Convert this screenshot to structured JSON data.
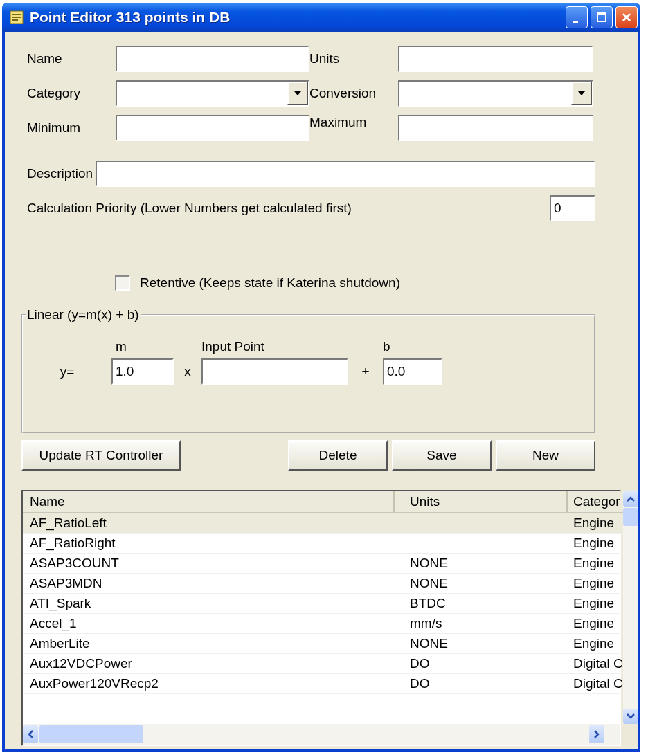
{
  "window": {
    "title": "Point Editor 313 points in DB"
  },
  "fields": {
    "name": {
      "label": "Name"
    },
    "units": {
      "label": "Units"
    },
    "category": {
      "label": "Category"
    },
    "conversion": {
      "label": "Conversion"
    },
    "minimum": {
      "label": "Minimum"
    },
    "maximum": {
      "label": "Maximum"
    },
    "description": {
      "label": "Description"
    },
    "priority": {
      "label": "Calculation Priority (Lower Numbers get calculated first)",
      "value": "0"
    }
  },
  "retentive": {
    "label": "Retentive (Keeps state if Katerina shutdown)",
    "checked": false
  },
  "linear": {
    "title": "Linear (y=m(x) + b)",
    "y_label": "y=",
    "m_label": "m",
    "m_value": "1.0",
    "times": "x",
    "input_label": "Input Point",
    "plus": "+",
    "b_label": "b",
    "b_value": "0.0"
  },
  "buttons": {
    "update": "Update RT Controller",
    "actions": [
      "Delete",
      "Save",
      "New"
    ]
  },
  "table": {
    "columns": [
      "Name",
      "Units",
      "Categor"
    ],
    "rows": [
      {
        "cells": [
          "AF_RatioLeft",
          "",
          "Engine"
        ],
        "selected": true
      },
      {
        "cells": [
          "AF_RatioRight",
          "",
          "Engine"
        ],
        "selected": false
      },
      {
        "cells": [
          "ASAP3COUNT",
          "NONE",
          "Engine"
        ],
        "selected": false
      },
      {
        "cells": [
          "ASAP3MDN",
          "NONE",
          "Engine"
        ],
        "selected": false
      },
      {
        "cells": [
          "ATI_Spark",
          "BTDC",
          "Engine"
        ],
        "selected": false
      },
      {
        "cells": [
          "Accel_1",
          "mm/s",
          "Engine"
        ],
        "selected": false
      },
      {
        "cells": [
          "AmberLite",
          "NONE",
          "Engine"
        ],
        "selected": false
      },
      {
        "cells": [
          "Aux12VDCPower",
          "DO",
          "Digital C"
        ],
        "selected": false
      },
      {
        "cells": [
          "AuxPower120VRecp2",
          "DO",
          "Digital C"
        ],
        "selected": false
      }
    ]
  }
}
